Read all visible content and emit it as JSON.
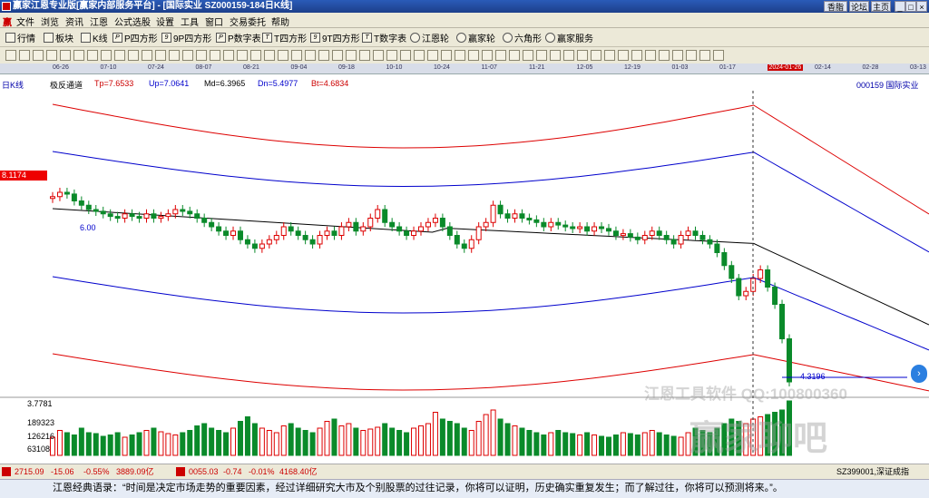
{
  "window": {
    "title": "赢家江恩专业版[赢家内部服务平台] - [国际实业  SZ000159-184日K线]",
    "buttons": [
      "香脂",
      "论坛",
      "主页"
    ]
  },
  "menu": [
    "文件",
    "浏览",
    "资讯",
    "江恩",
    "公式选股",
    "设置",
    "工具",
    "窗口",
    "交易委托",
    "帮助"
  ],
  "toolbar": [
    "行情",
    "板块",
    "K线",
    "P四方形",
    "9P四方形",
    "P数字表",
    "T四方形",
    "9T四方形",
    "T数字表",
    "江恩轮",
    "赢家轮",
    "六角形",
    "赢家服务"
  ],
  "toolbar_icons": [
    "quote-icon",
    "sector-icon",
    "kline-icon",
    "p-square-icon",
    "9p-square-icon",
    "p-table-icon",
    "t-square-icon",
    "9t-square-icon",
    "t-table-icon",
    "gann-wheel-icon",
    "winner-wheel-icon",
    "hexagon-icon",
    "service-icon"
  ],
  "dates": [
    "06-26",
    "07-10",
    "07-24",
    "08-07",
    "08-21",
    "09-04",
    "09-18",
    "10-10",
    "10-24",
    "11-07",
    "11-21",
    "12-05",
    "12-19",
    "01-03",
    "01-17",
    "2024-01-26",
    "02-14",
    "02-28",
    "03-13"
  ],
  "panel": {
    "period": "日K线",
    "indicator": "极反通道",
    "tp": "Tp=7.6533",
    "up": "Up=7.0641",
    "md": "Md=6.3965",
    "dn": "Dn=5.4977",
    "bt": "Bt=4.6834",
    "stock": "000159  国际实业",
    "price_tag": "8.1174",
    "low_label": "4.3196",
    "left_label": "6.00"
  },
  "volume": {
    "ticks": [
      "3.7781",
      "189323",
      "126216",
      "63108"
    ]
  },
  "status": {
    "sh": "2715.09",
    "sh_chg": "-15.06",
    "sh_pct": "-0.55%",
    "sh_amt": "3889.09亿",
    "sz_code": "0055.03",
    "sz_chg": "-0.74",
    "sz_pct": "-0.01%",
    "sz_amt": "4168.40亿",
    "right": "SZ399001,深证成指"
  },
  "quote": "江恩经典语录：“时间是决定市场走势的重要因素，经过详细研究大市及个别股票的过往记录，你将可以证明，历史确实重复发生；而了解过往，你将可以预测将来。”。",
  "watermark": {
    "line1": "江恩工具软件  QQ:100800360",
    "line2": "赢家聊吧"
  },
  "chart_data": {
    "type": "candlestick",
    "symbol": "000159",
    "closes": [
      6.65,
      6.7,
      6.68,
      6.6,
      6.55,
      6.5,
      6.48,
      6.45,
      6.42,
      6.4,
      6.45,
      6.42,
      6.4,
      6.45,
      6.4,
      6.42,
      6.45,
      6.5,
      6.48,
      6.45,
      6.4,
      6.35,
      6.3,
      6.25,
      6.2,
      6.25,
      6.15,
      6.1,
      6.05,
      6.1,
      6.15,
      6.2,
      6.3,
      6.25,
      6.2,
      6.15,
      6.1,
      6.2,
      6.25,
      6.2,
      6.3,
      6.35,
      6.25,
      6.3,
      6.4,
      6.5,
      6.35,
      6.3,
      6.25,
      6.2,
      6.25,
      6.3,
      6.35,
      6.4,
      6.3,
      6.2,
      6.1,
      6.05,
      6.15,
      6.3,
      6.35,
      6.55,
      6.45,
      6.4,
      6.45,
      6.4,
      6.38,
      6.35,
      6.3,
      6.35,
      6.32,
      6.3,
      6.28,
      6.3,
      6.25,
      6.3,
      6.28,
      6.25,
      6.2,
      6.22,
      6.18,
      6.15,
      6.2,
      6.25,
      6.2,
      6.15,
      6.1,
      6.2,
      6.25,
      6.2,
      6.15,
      6.1,
      6.0,
      5.85,
      5.7,
      5.5,
      5.55,
      5.7,
      5.8,
      5.6,
      5.4,
      5.0,
      4.5
    ],
    "channel": {
      "Tp": 7.6533,
      "Up": 7.0641,
      "Md": 6.3965,
      "Dn": 5.4977,
      "Bt": 4.6834
    },
    "volumes": [
      40,
      55,
      50,
      45,
      60,
      50,
      48,
      42,
      45,
      50,
      40,
      45,
      50,
      55,
      60,
      52,
      48,
      45,
      50,
      55,
      65,
      70,
      60,
      55,
      50,
      60,
      75,
      85,
      70,
      60,
      55,
      50,
      65,
      70,
      60,
      55,
      50,
      60,
      75,
      80,
      65,
      70,
      60,
      55,
      58,
      62,
      70,
      60,
      55,
      50,
      60,
      65,
      70,
      95,
      80,
      75,
      70,
      60,
      55,
      75,
      90,
      100,
      80,
      70,
      65,
      60,
      55,
      50,
      45,
      50,
      55,
      50,
      48,
      45,
      50,
      45,
      42,
      40,
      45,
      50,
      48,
      45,
      50,
      55,
      50,
      45,
      42,
      40,
      50,
      60,
      55,
      50,
      60,
      70,
      80,
      75,
      70,
      80,
      85,
      90,
      95,
      100,
      120
    ]
  }
}
